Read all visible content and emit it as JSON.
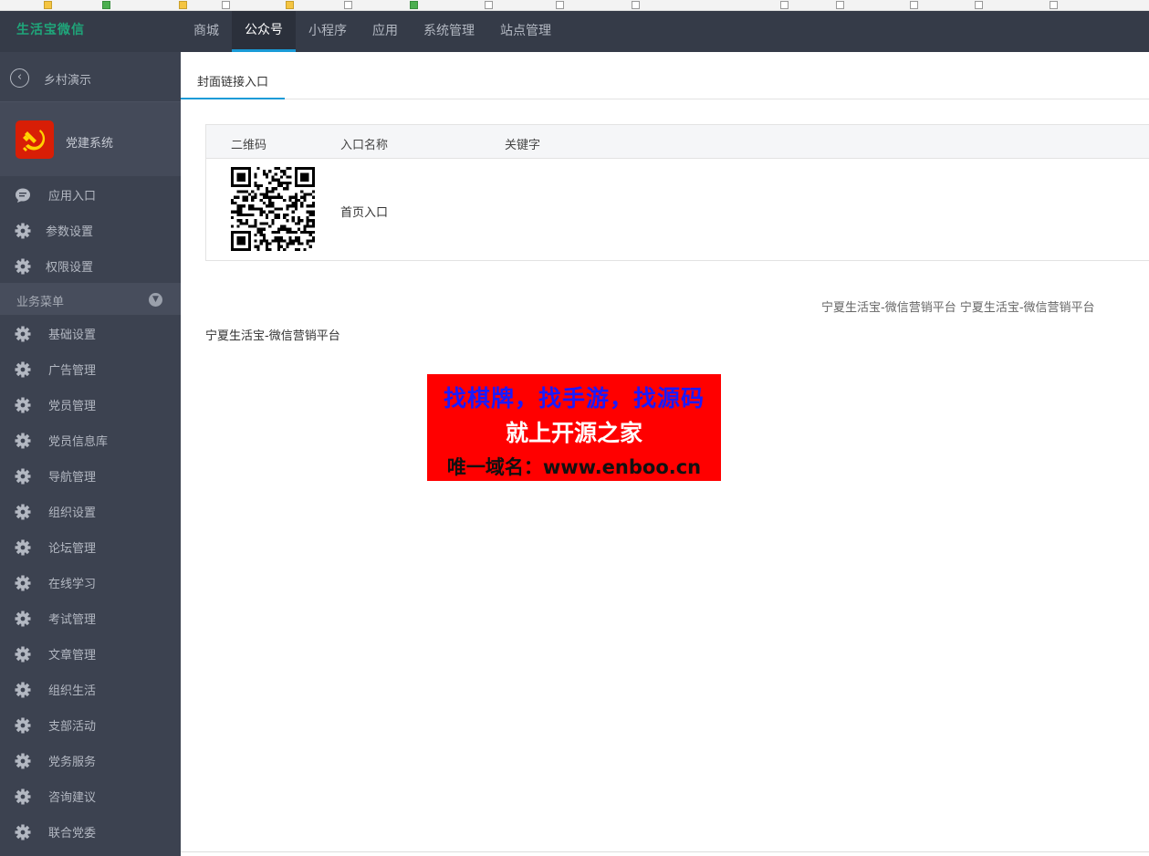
{
  "header": {
    "logo": "生活宝微信",
    "nav": [
      "商城",
      "公众号",
      "小程序",
      "应用",
      "系统管理",
      "站点管理"
    ],
    "active_nav": 1
  },
  "sidebar": {
    "back_label": "乡村演示",
    "module_label": "党建系统",
    "top_items": [
      {
        "label": "应用入口",
        "icon": "chat-icon"
      },
      {
        "label": "参数设置",
        "icon": "gear-icon"
      },
      {
        "label": "权限设置",
        "icon": "gear-icon"
      }
    ],
    "group_title": "业务菜单",
    "group_items": [
      "基础设置",
      "广告管理",
      "党员管理",
      "党员信息库",
      "导航管理",
      "组织设置",
      "论坛管理",
      "在线学习",
      "考试管理",
      "文章管理",
      "组织生活",
      "支部活动",
      "党务服务",
      "咨询建议",
      "联合党委"
    ]
  },
  "main": {
    "tab": "封面链接入口",
    "table": {
      "headers": [
        "二维码",
        "入口名称",
        "关键字"
      ],
      "rows": [
        {
          "name": "首页入口",
          "keyword": ""
        }
      ]
    },
    "footer_right": "宁夏生活宝-微信营销平台 宁夏生活宝-微信营销平台",
    "footer_left": "宁夏生活宝-微信营销平台"
  },
  "ad": {
    "line1": "找棋牌，找手游，找源码",
    "line2": "就上开源之家",
    "line3": "唯一域名：www.enboo.cn"
  },
  "colors": {
    "topbar": "#353b48",
    "sidebar": "#3c4250",
    "accent": "#1a9bd7",
    "ad_bg": "#ff0000"
  }
}
